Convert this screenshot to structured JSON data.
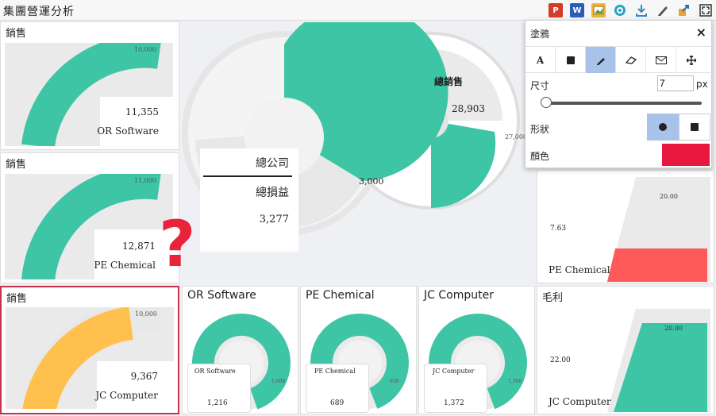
{
  "app": {
    "title": "集團營運分析"
  },
  "toolbar": {
    "icons": [
      "powerpoint-icon",
      "word-icon",
      "image-export-icon",
      "target-icon",
      "download-icon",
      "pen-icon",
      "share-icon",
      "fullscreen-icon"
    ],
    "ppt_glyph": "P",
    "word_glyph": "W"
  },
  "panels": {
    "or_gauge": {
      "title": "銷售",
      "max": "10,000",
      "value": "11,355",
      "label": "OR Software",
      "fraction": 1.0,
      "color": "#3ec5a6"
    },
    "pe_gauge": {
      "title": "銷售",
      "max": "11,000",
      "value": "12,871",
      "label": "PE Chemical",
      "fraction": 1.0,
      "color": "#3ec5a6"
    },
    "jc_gauge": {
      "title": "銷售",
      "max": "10,000",
      "value": "9,367",
      "label": "JC Computer",
      "fraction": 0.94,
      "color": "#ffc04d"
    }
  },
  "center": {
    "company": "總公司",
    "profit_label": "總損益",
    "profit_value": "3,277",
    "donut_value": "3,000",
    "sales_label": "總銷售",
    "sales_value": "28,903",
    "sales_max": "27,000"
  },
  "bottom": {
    "or": {
      "title": "OR Software",
      "label": "OR Software",
      "value": "1,216",
      "target": "1,000"
    },
    "pe": {
      "title": "PE Chemical",
      "label": "PE Chemical",
      "value": "689",
      "target": "650"
    },
    "jc": {
      "title": "JC Computer",
      "label": "JC Computer",
      "value": "1,372",
      "target": "1,300"
    }
  },
  "margin": {
    "pe": {
      "target": "20.00",
      "value": "7.63",
      "label": "PE Chemical",
      "color": "#ff5a5a"
    },
    "jc": {
      "title": "毛利",
      "target": "20.00",
      "value": "22.00",
      "label": "JC Computer",
      "color": "#3ec5a6"
    }
  },
  "annotation": {
    "glyph": "?",
    "color": "#e8243c"
  },
  "draw_panel": {
    "title": "塗鴉",
    "close": "×",
    "tools": [
      "text-tool",
      "rect-tool",
      "pen-tool",
      "eraser-tool",
      "mail-tool",
      "move-tool"
    ],
    "text_tool_glyph": "A",
    "size_label": "尺寸",
    "size_value": "7",
    "size_unit": "px",
    "shape_label": "形狀",
    "color_label": "顏色",
    "color_value": "#e8173f",
    "selected_tool": "pen-tool",
    "selected_shape": "circle"
  }
}
